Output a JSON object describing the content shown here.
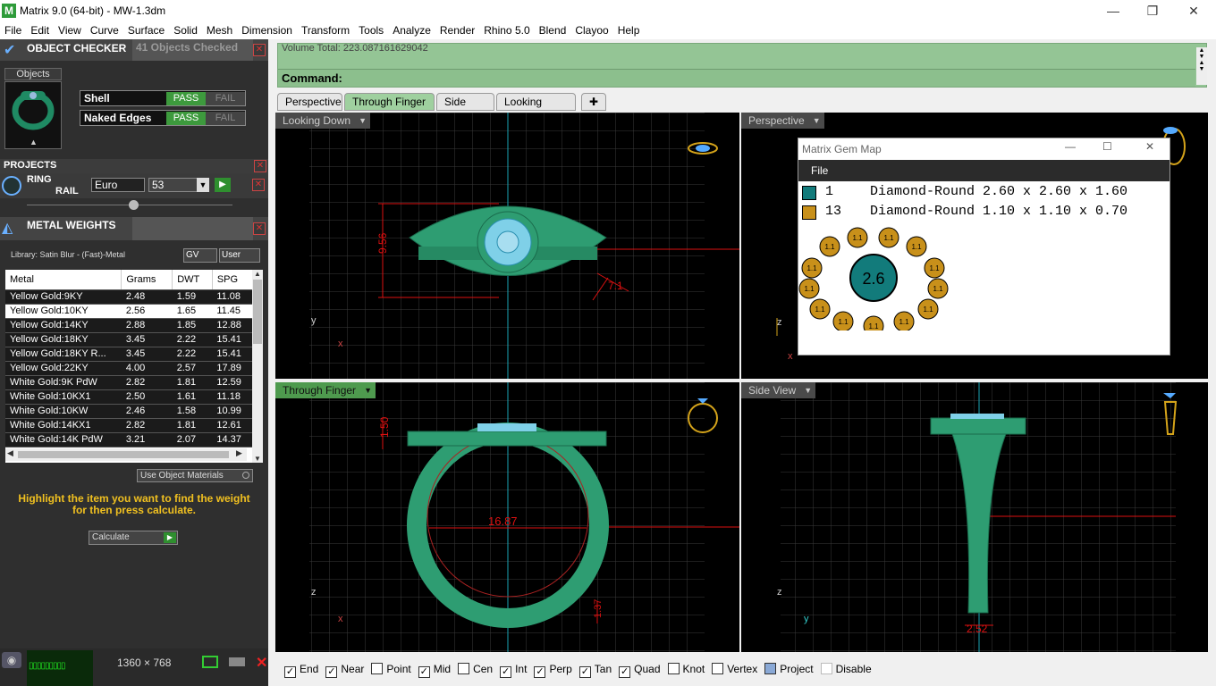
{
  "window": {
    "title": "Matrix 9.0 (64-bit) - MW-1.3dm",
    "minimize": "—",
    "maximize": "❐",
    "close": "✕"
  },
  "menu": [
    "File",
    "Edit",
    "View",
    "Curve",
    "Surface",
    "Solid",
    "Mesh",
    "Dimension",
    "Transform",
    "Tools",
    "Analyze",
    "Render",
    "Rhino 5.0",
    "Blend",
    "Clayoo",
    "Help"
  ],
  "object_checker": {
    "title": "OBJECT CHECKER",
    "summary": "41  Objects Checked",
    "objects_tab": "Objects",
    "rows": [
      {
        "label": "Shell",
        "pass": "PASS",
        "fail": "FAIL"
      },
      {
        "label": "Naked Edges",
        "pass": "PASS",
        "fail": "FAIL"
      }
    ]
  },
  "projects": {
    "title": "PROJECTS",
    "ring_label": "RING",
    "rail_label": "RAIL",
    "size_system": "Euro",
    "size_value": "53"
  },
  "metal_weights": {
    "title": "METAL WEIGHTS",
    "library": "Library: Satin Blur - (Fast)-Metal",
    "gv": "GV",
    "user": "User",
    "columns": [
      "Metal",
      "Grams",
      "DWT",
      "SPG"
    ],
    "rows": [
      [
        "Yellow Gold:9KY",
        "2.48",
        "1.59",
        "11.08"
      ],
      [
        "Yellow Gold:10KY",
        "2.56",
        "1.65",
        "11.45"
      ],
      [
        "Yellow Gold:14KY",
        "2.88",
        "1.85",
        "12.88"
      ],
      [
        "Yellow Gold:18KY",
        "3.45",
        "2.22",
        "15.41"
      ],
      [
        "Yellow Gold:18KY R...",
        "3.45",
        "2.22",
        "15.41"
      ],
      [
        "Yellow Gold:22KY",
        "4.00",
        "2.57",
        "17.89"
      ],
      [
        "White Gold:9K PdW",
        "2.82",
        "1.81",
        "12.59"
      ],
      [
        "White Gold:10KX1",
        "2.50",
        "1.61",
        "11.18"
      ],
      [
        "White Gold:10KW",
        "2.46",
        "1.58",
        "10.99"
      ],
      [
        "White Gold:14KX1",
        "2.82",
        "1.81",
        "12.61"
      ],
      [
        "White Gold:14K PdW",
        "3.21",
        "2.07",
        "14.37"
      ]
    ],
    "use_object_materials": "Use Object Materials",
    "hint": "Highlight the item you want to find the weight for then press calculate.",
    "calculate": "Calculate"
  },
  "status_bottom": {
    "resolution": "1360 × 768"
  },
  "command": {
    "volume_line": "Volume Total: 223.087161629042",
    "label": "Command:"
  },
  "tabs": [
    "Perspective",
    "Through Finger",
    "Side View",
    "Looking Down"
  ],
  "viewports": {
    "top_left": "Looking Down",
    "top_right": "Perspective",
    "bottom_left": "Through Finger",
    "bottom_right": "Side View"
  },
  "dims": {
    "d1": "9.56",
    "d2": "7.1",
    "d3": "1.50",
    "d4": "16.87",
    "d5": "1.37",
    "d6": "2.52"
  },
  "axes": {
    "y": "y",
    "x": "x",
    "z": "z"
  },
  "gem_map": {
    "title": "Matrix Gem Map",
    "menu_file": "File",
    "rows": [
      {
        "count": "1",
        "desc": "Diamond-Round 2.60 x 2.60 x 1.60",
        "color": "#127b7b"
      },
      {
        "count": "13",
        "desc": "Diamond-Round 1.10 x 1.10 x 0.70",
        "color": "#c8901a"
      }
    ],
    "center_label": "2.6",
    "small_label": "1.1"
  },
  "snaps": [
    {
      "label": "End",
      "checked": true
    },
    {
      "label": "Near",
      "checked": true
    },
    {
      "label": "Point",
      "checked": false
    },
    {
      "label": "Mid",
      "checked": true
    },
    {
      "label": "Cen",
      "checked": false
    },
    {
      "label": "Int",
      "checked": true
    },
    {
      "label": "Perp",
      "checked": true
    },
    {
      "label": "Tan",
      "checked": true
    },
    {
      "label": "Quad",
      "checked": true
    },
    {
      "label": "Knot",
      "checked": false
    },
    {
      "label": "Vertex",
      "checked": false
    },
    {
      "label": "Project",
      "checked": true
    },
    {
      "label": "Disable",
      "checked": false
    }
  ],
  "colors": {
    "ring_green": "#2e9d72",
    "panel_green": "#94c595",
    "dim_red": "#d11",
    "gold": "#d4a31a"
  }
}
